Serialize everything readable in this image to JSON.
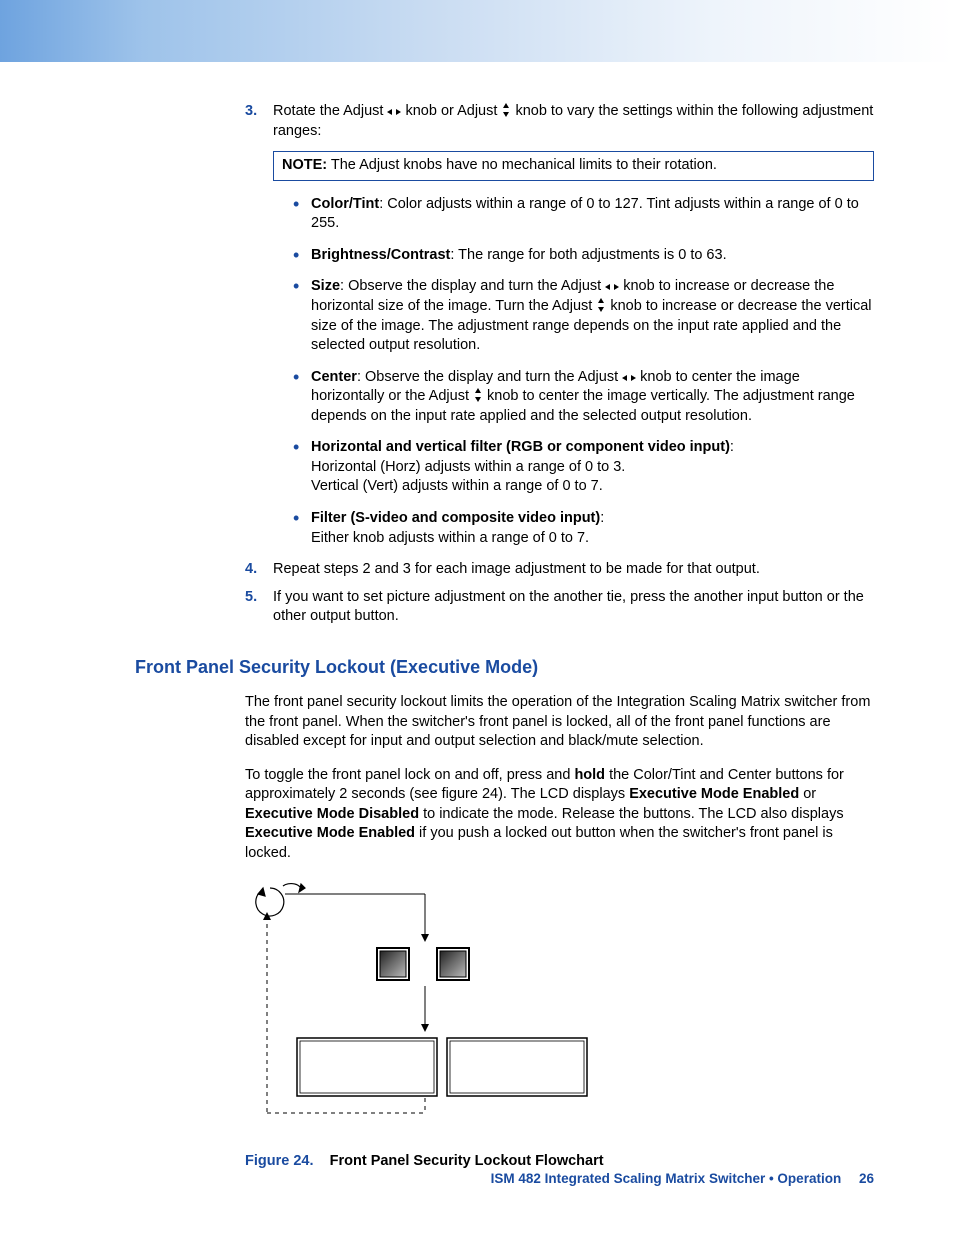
{
  "steps": {
    "s3": {
      "num": "3.",
      "intro_a": "Rotate the Adjust ",
      "intro_b": " knob or Adjust ",
      "intro_c": " knob to vary the settings within the following adjustment ranges:",
      "note_label": "NOTE:",
      "note_text": "  The Adjust knobs have no mechanical limits to their rotation.",
      "bullets": {
        "color": {
          "label": "Color/Tint",
          "text": ":  Color adjusts within a range of 0 to 127. Tint adjusts within a range of 0 to 255."
        },
        "bright": {
          "label": "Brightness/Contrast",
          "text": ":  The range for both adjustments is 0 to 63."
        },
        "size": {
          "label": "Size",
          "t1": ": Observe the display and turn the Adjust ",
          "t2": " knob to increase or decrease the horizontal size of the image.  Turn the Adjust ",
          "t3": " knob to increase or decrease the vertical size of the image.  The adjustment range depends on the input rate applied and the selected output resolution."
        },
        "center": {
          "label": "Center",
          "t1": ": Observe the display and turn the Adjust ",
          "t2": " knob to center the image horizontally or the Adjust ",
          "t3": " knob to center the image vertically.  The adjustment range depends on the input rate applied and the selected output resolution."
        },
        "hv_filter": {
          "label": "Horizontal and vertical filter (RGB or component video input)",
          "line1": "Horizontal (Horz) adjusts within a range of 0 to 3.",
          "line2": "Vertical (Vert) adjusts within a range of 0 to 7."
        },
        "filter": {
          "label": "Filter (S-video and composite video input)",
          "line1": "Either knob adjusts within a range of 0 to 7."
        }
      }
    },
    "s4": {
      "num": "4.",
      "text": "Repeat steps 2 and 3 for each image adjustment to be made for that output."
    },
    "s5": {
      "num": "5.",
      "text": "If you want to set picture adjustment on the another tie, press the another input button or the other output button."
    }
  },
  "section": {
    "heading": "Front Panel Security Lockout (Executive Mode)",
    "p1": "The front panel security lockout limits the operation of the Integration Scaling Matrix switcher from the front panel.  When the switcher's front panel is locked, all of the front panel functions are disabled except for input and output selection and black/mute selection.",
    "p2_a": "To toggle the front panel lock on and off, press and ",
    "p2_hold": "hold",
    "p2_b": " the Color/Tint and Center buttons for approximately 2 seconds (see figure 24).  The LCD displays ",
    "p2_eme": "Executive Mode Enabled",
    "p2_c": " or ",
    "p2_emd": "Executive Mode Disabled",
    "p2_d": " to indicate the mode.  Release the buttons.  The LCD also displays ",
    "p2_eme2": "Executive Mode Enabled",
    "p2_e": " if you push a locked out button when the switcher's front panel is locked."
  },
  "figure": {
    "label": "Figure 24.",
    "caption": "Front Panel Security Lockout Flowchart"
  },
  "footer": {
    "doc": "ISM 482 Integrated Scaling Matrix Switcher • Operation",
    "page": "26"
  }
}
